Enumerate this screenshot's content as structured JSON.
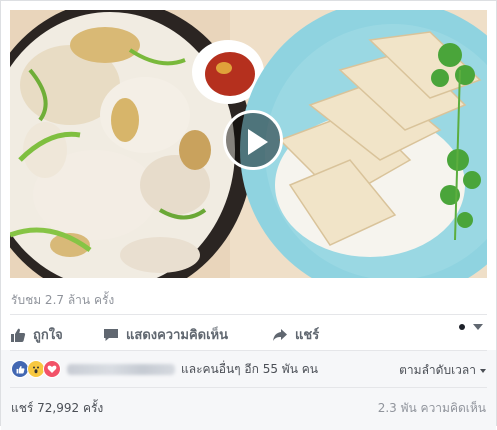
{
  "video": {
    "thumbnail_subject": "chicken-rice-dishes",
    "play_icon": "play-icon"
  },
  "views_text": "รับชม 2.7 ล้าน ครั้ง",
  "actions": {
    "like": {
      "label": "ถูกใจ",
      "icon": "thumbs-up-icon"
    },
    "comment": {
      "label": "แสดงความคิดเห็น",
      "icon": "comment-icon"
    },
    "share": {
      "label": "แชร์",
      "icon": "share-arrow-icon"
    },
    "more_icon": "more-options-icon"
  },
  "reactions": {
    "icons": [
      "like-reaction-icon",
      "wow-reaction-icon",
      "love-reaction-icon"
    ],
    "others_text": "และคนอื่นๆ อีก 55 พัน คน"
  },
  "sort_label": "ตามลำดับเวลา",
  "shares_text": "แชร์ 72,992 ครั้ง",
  "comments_text": "2.3 พัน ความคิดเห็น",
  "colors": {
    "like_blue": "#4267b2",
    "love_red": "#f25268",
    "wow_yellow": "#f7c840",
    "plate_blue": "#8fd3e0",
    "muted_text": "#90949c"
  }
}
